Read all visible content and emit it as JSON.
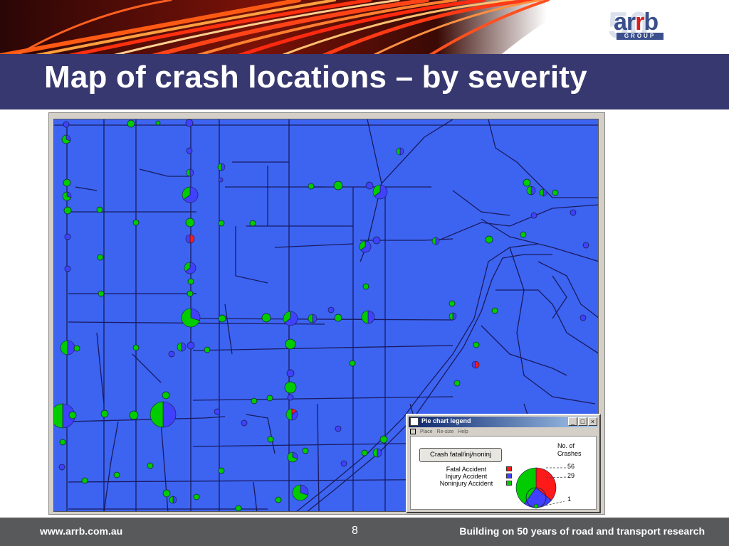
{
  "slide": {
    "title": "Map of crash locations – by severity",
    "logo_text": "arrb",
    "logo_sub": "GROUP",
    "logo_number": "50"
  },
  "footer": {
    "website": "www.arrb.com.au",
    "page_number": "8",
    "tagline": "Building on 50 years of road and transport research"
  },
  "legend_window": {
    "title": "Pie chart legend",
    "menu": [
      "Place",
      "Re-size",
      "Help"
    ],
    "button_label": "Crash fatal/inj/noninj",
    "categories": [
      {
        "label": "Fatal Accident",
        "color": "#ff1a1a"
      },
      {
        "label": "Injury Accident",
        "color": "#4040ff"
      },
      {
        "label": "Noninjury Accident",
        "color": "#00cc00"
      }
    ],
    "num_title": "No. of\nCrashes",
    "scale_values": [
      "56",
      "29",
      "1"
    ]
  },
  "colors": {
    "map_background": "#3c64f0",
    "road": "#1a1a60",
    "title_bar": "#383870",
    "footer": "#58595b",
    "fatal": "#ff1a1a",
    "injury": "#4040ff",
    "noninjury": "#00cc00"
  },
  "chart_data": {
    "type": "map-pie-markers",
    "series": [
      {
        "name": "Fatal Accident",
        "color": "#ff1a1a"
      },
      {
        "name": "Injury Accident",
        "color": "#4040ff"
      },
      {
        "name": "Noninjury Accident",
        "color": "#00cc00"
      }
    ],
    "scale_crashes": [
      56,
      29,
      1
    ]
  }
}
